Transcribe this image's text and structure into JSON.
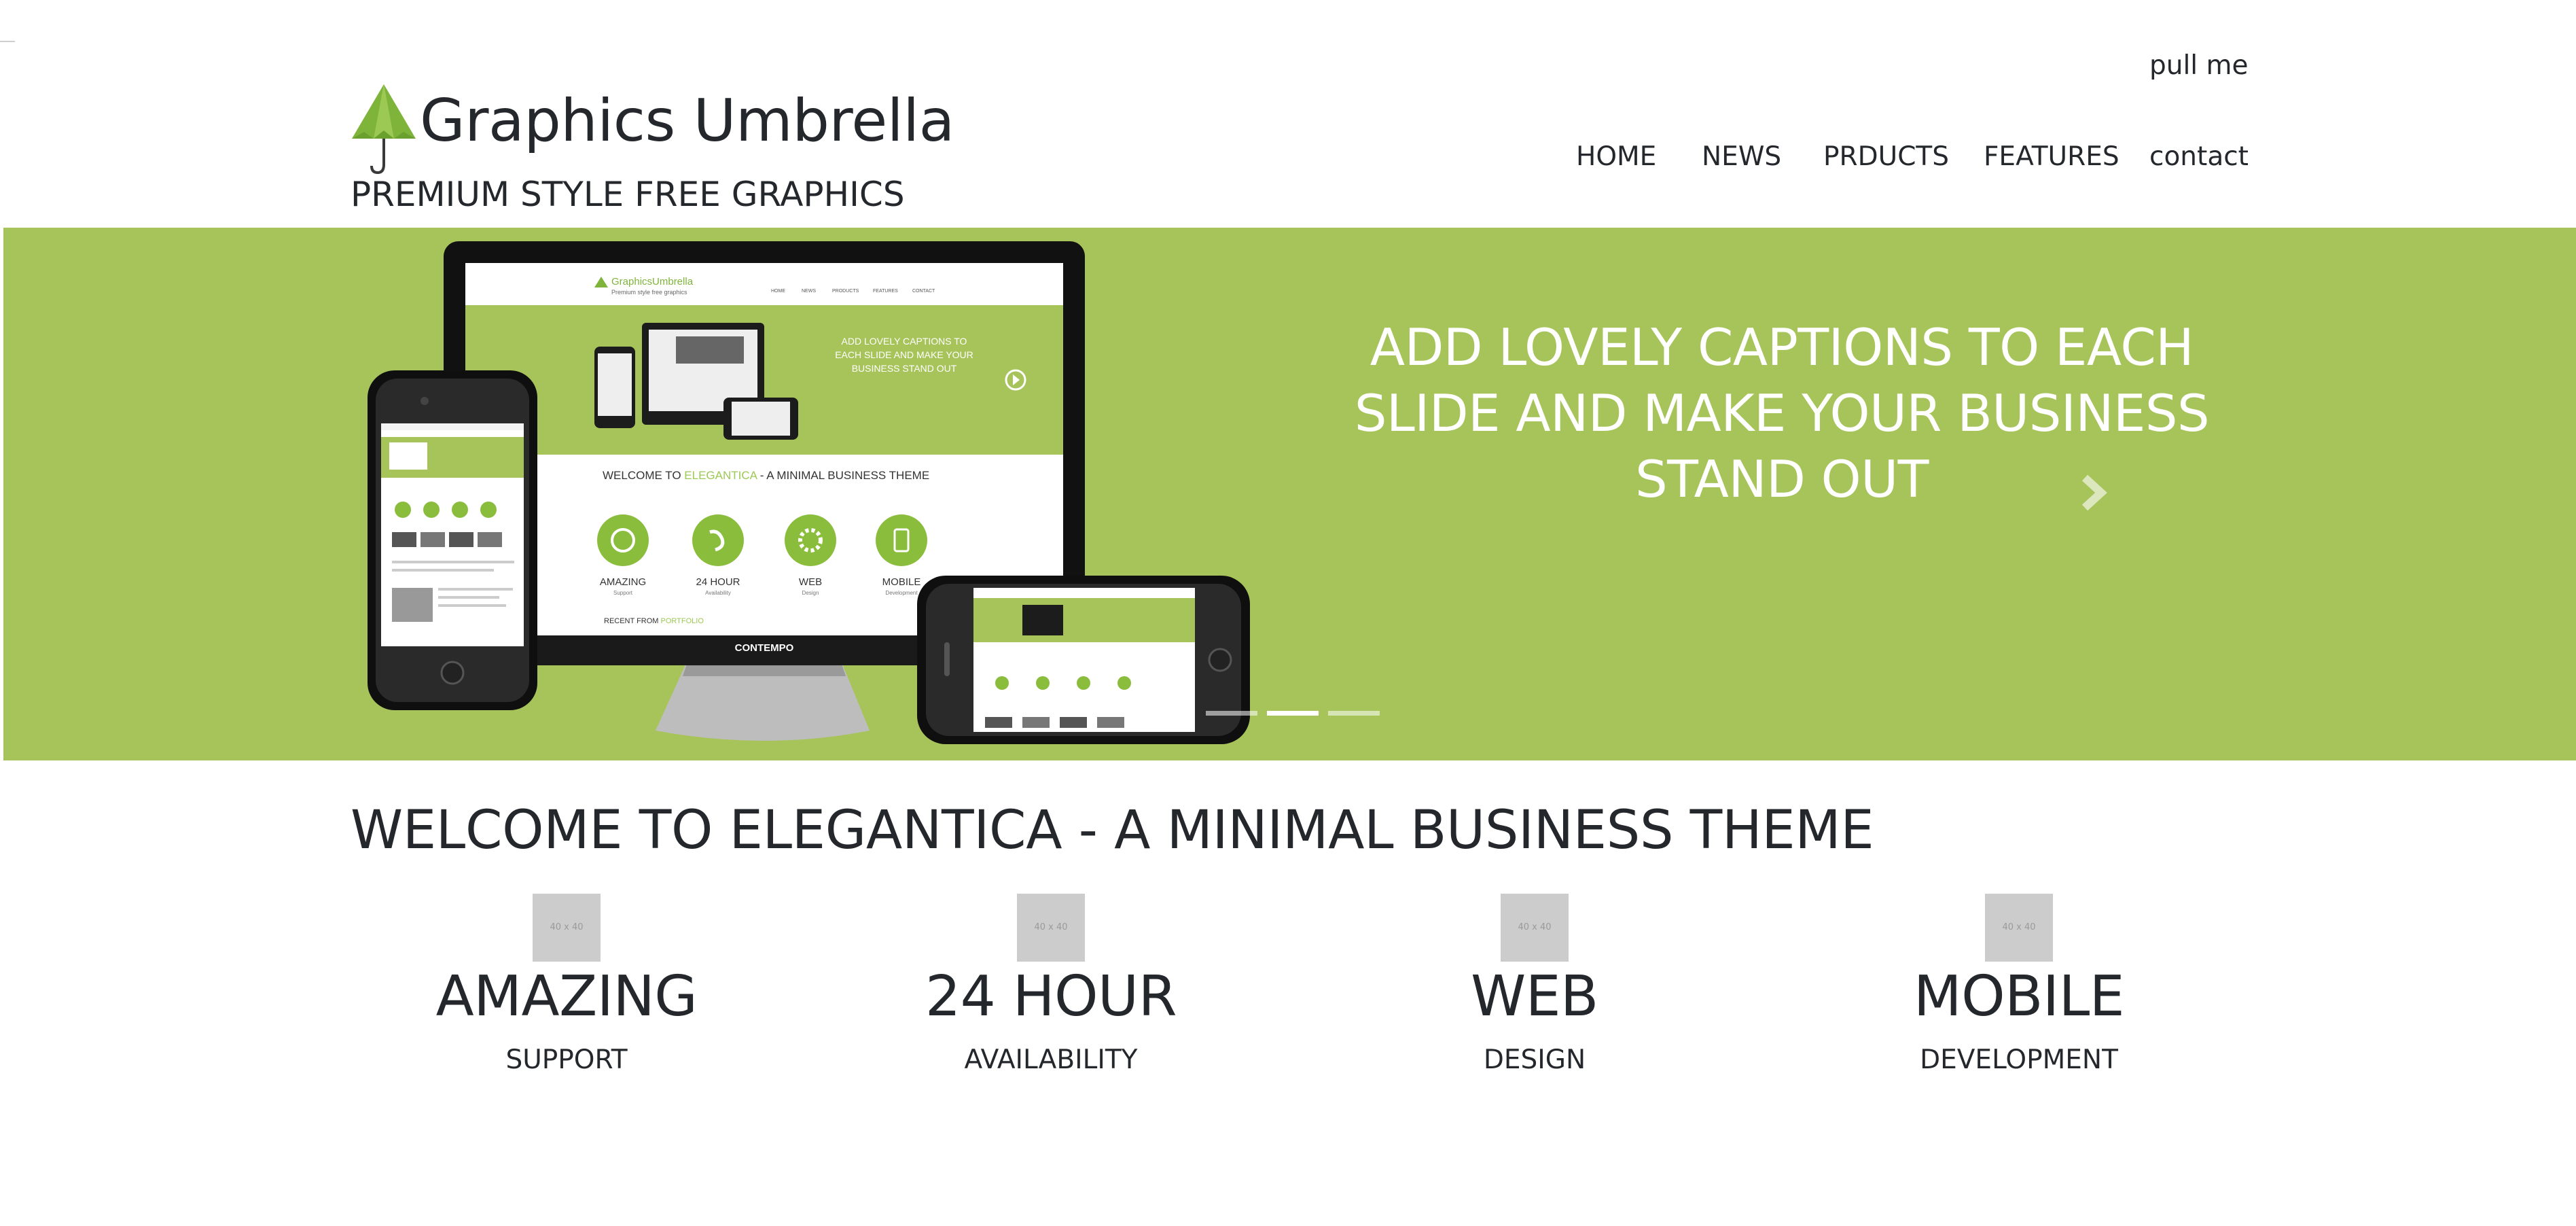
{
  "header": {
    "site_name": "Graphics Umbrella",
    "tagline": "PREMIUM STYLE FREE GRAPHICS",
    "pull_me": "pull me",
    "nav": [
      "HOME",
      "NEWS",
      "PRDUCTS",
      "FEATURES",
      "contact"
    ]
  },
  "slider": {
    "caption_lines": [
      "ADD LOVELY CAPTIONS TO EACH",
      "SLIDE AND MAKE YOUR BUSINESS",
      "STAND OUT"
    ],
    "next_icon": "chevron-right-icon",
    "active_dot": 2,
    "dot_count": 3,
    "mockup": {
      "site_name": "GraphicsUmbrella",
      "tagline": "Premium style free graphics",
      "nav": [
        "HOME",
        "NEWS",
        "PRODUCTS",
        "FEATURES",
        "CONTACT"
      ],
      "caption": [
        "ADD LOVELY CAPTIONS TO",
        "EACH SLIDE AND MAKE YOUR",
        "BUSINESS STAND OUT"
      ],
      "welcome_prefix": "WELCOME TO ",
      "welcome_brand": "ELEGANTICA",
      "welcome_suffix": " - A MINIMAL BUSINESS THEME",
      "features": [
        {
          "title": "AMAZING",
          "sub": "Support"
        },
        {
          "title": "24 HOUR",
          "sub": "Availability"
        },
        {
          "title": "WEB",
          "sub": "Design"
        },
        {
          "title": "MOBILE",
          "sub": "Development"
        }
      ],
      "recent_prefix": "RECENT FROM ",
      "recent_link": "PORTFOLIO",
      "monitor_label": "CONTEMPO"
    }
  },
  "welcome": "WELCOME TO ELEGANTICA - A MINIMAL BUSINESS THEME",
  "features": [
    {
      "placeholder": "40 x 40",
      "title": "AMAZING",
      "sub": "SUPPORT"
    },
    {
      "placeholder": "40 x 40",
      "title": "24 HOUR",
      "sub": "AVAILABILITY"
    },
    {
      "placeholder": "40 x 40",
      "title": "WEB",
      "sub": "DESIGN"
    },
    {
      "placeholder": "40 x 40",
      "title": "MOBILE",
      "sub": "DEVELOPMENT"
    }
  ],
  "colors": {
    "brand_green": "#a7c45a",
    "text": "#24282c",
    "placeholder_bg": "#cccccc"
  }
}
